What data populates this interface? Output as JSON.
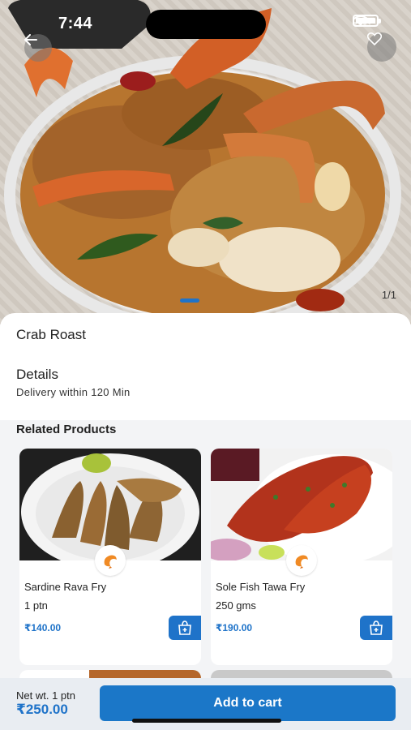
{
  "status_bar": {
    "time": "7:44",
    "icons": [
      "signal-icon",
      "wifi-icon",
      "battery-icon"
    ]
  },
  "hero": {
    "back_icon": "arrow-left-icon",
    "favorite_icon": "heart-icon",
    "image_counter": "1/1"
  },
  "product": {
    "name": "Crab Roast",
    "details_title": "Details",
    "details_text": "Delivery within 120 Min"
  },
  "related": {
    "title": "Related Products",
    "items": [
      {
        "name": "Sardine Rava Fry",
        "quantity": "1 ptn",
        "price": "₹140.00",
        "badge_icon": "shrimp-icon",
        "add_icon": "add-to-bag-icon"
      },
      {
        "name": "Sole Fish Tawa Fry",
        "quantity": "250 gms",
        "price": "₹190.00",
        "badge_icon": "shrimp-icon",
        "add_icon": "add-to-bag-icon"
      }
    ]
  },
  "bottom_bar": {
    "net_weight": "Net wt. 1 ptn",
    "total": "₹250.00",
    "cta": "Add to cart"
  },
  "colors": {
    "accent": "#1f73c9",
    "button": "#1b77c8",
    "background": "#f3f4f6"
  }
}
